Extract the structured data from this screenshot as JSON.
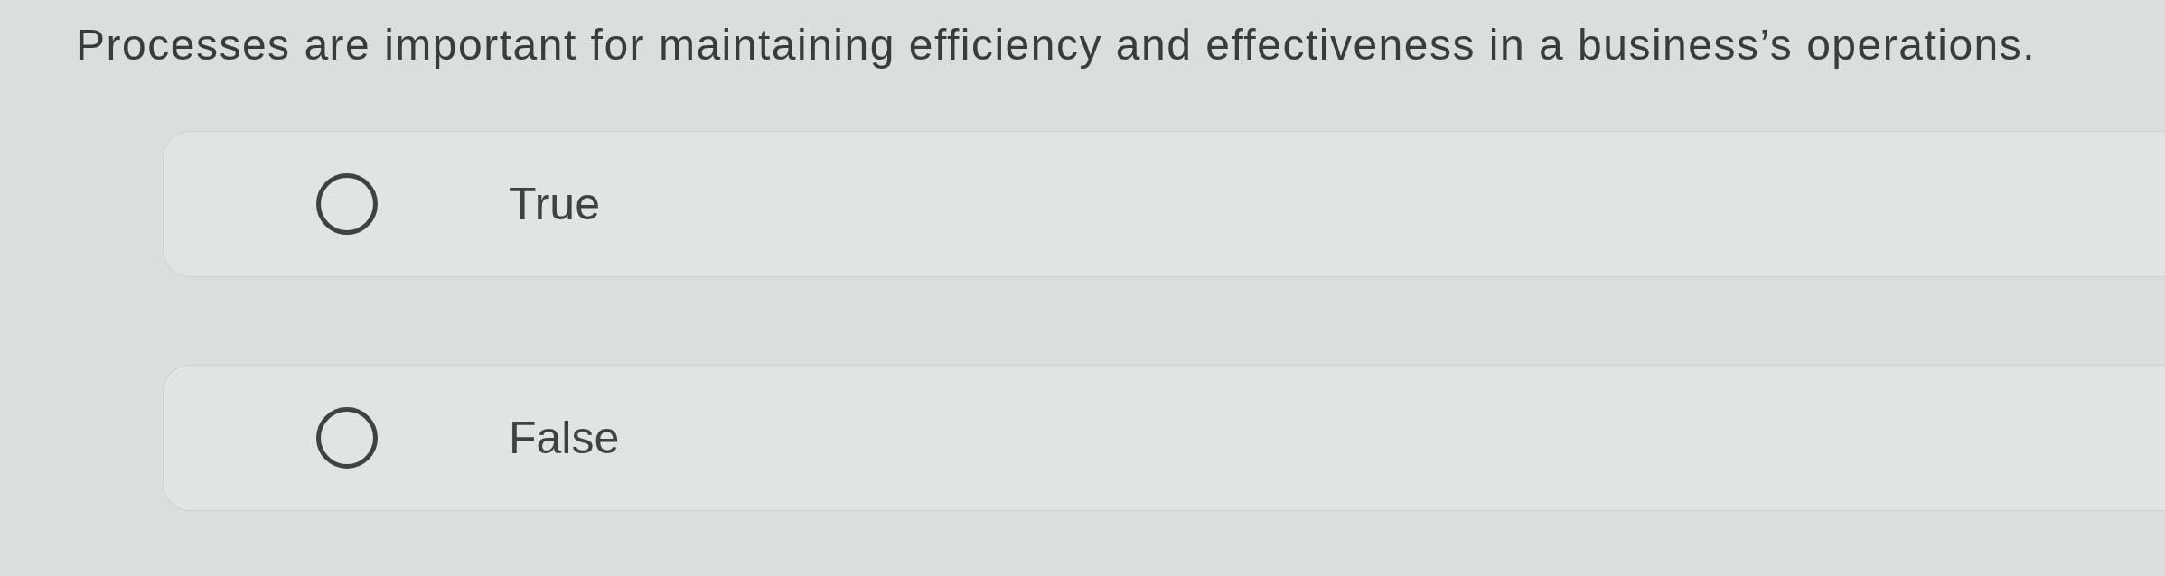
{
  "question": "Processes are important for maintaining efficiency and effectiveness in a business’s operations.",
  "options": [
    {
      "label": "True",
      "selected": false
    },
    {
      "label": "False",
      "selected": false
    }
  ]
}
